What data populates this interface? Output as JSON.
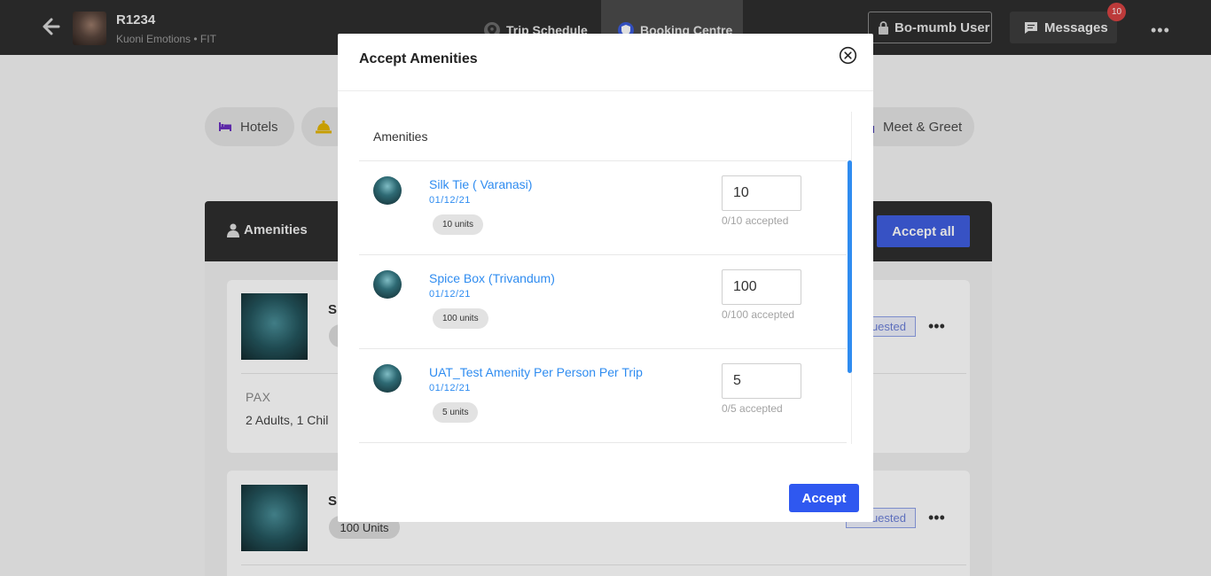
{
  "header": {
    "trip_code": "R1234",
    "trip_subtitle": "Kuoni Emotions • FIT",
    "tabs": [
      {
        "label": "Trip Schedule",
        "icon": "location-pin-icon"
      },
      {
        "label": "Booking Centre",
        "icon": "shield-icon",
        "active": true
      }
    ],
    "user_label": "Bo-mumb User",
    "messages_label": "Messages",
    "messages_badge": "10"
  },
  "categories": [
    {
      "label": "Hotels",
      "icon": "bed-icon"
    },
    {
      "label": "",
      "icon": "bell-icon"
    },
    {
      "label": "Meet & Greet",
      "icon": "person-icon"
    }
  ],
  "panel": {
    "title": "Amenities",
    "accept_all_label": "Accept all",
    "cards": [
      {
        "name_fragment": "S",
        "status_fragment": "uested",
        "pax_label": "PAX",
        "pax_value_fragment": "2 Adults, 1 Chil"
      },
      {
        "name_fragment": "S",
        "units_label": "100 Units",
        "status_fragment": "uested"
      }
    ]
  },
  "modal": {
    "title": "Accept Amenities",
    "list_heading": "Amenities",
    "accept_label": "Accept",
    "items": [
      {
        "name": "Silk Tie ( Varanasi)",
        "date": "01/12/21",
        "units": "10 units",
        "value": "10",
        "accepted": "0/10 accepted"
      },
      {
        "name": "Spice Box (Trivandum)",
        "date": "01/12/21",
        "units": "100 units",
        "value": "100",
        "accepted": "0/100 accepted"
      },
      {
        "name": "UAT_Test Amenity Per Person Per Trip",
        "date": "01/12/21",
        "units": "5 units",
        "value": "5",
        "accepted": "0/5 accepted"
      }
    ]
  },
  "colors": {
    "topbar": "#2e2e2e",
    "accent_blue": "#2f58f0",
    "link_blue": "#2f8cf0",
    "badge_red": "#d64343"
  }
}
